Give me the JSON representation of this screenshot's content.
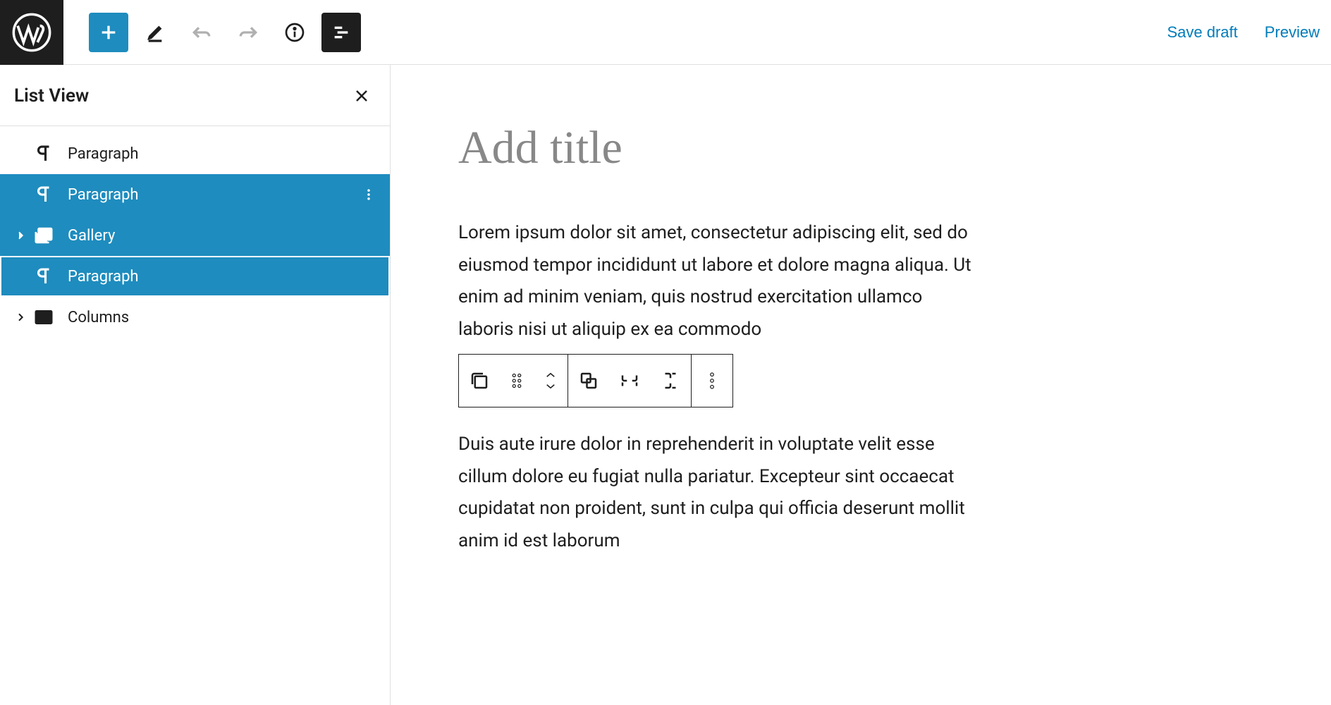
{
  "topbar": {
    "save_draft": "Save draft",
    "preview": "Preview"
  },
  "sidebar": {
    "title": "List View",
    "items": [
      {
        "type": "paragraph",
        "label": "Paragraph",
        "selected": false,
        "expandable": false
      },
      {
        "type": "paragraph",
        "label": "Paragraph",
        "selected": true,
        "expandable": false,
        "showOptions": true
      },
      {
        "type": "gallery",
        "label": "Gallery",
        "selected": true,
        "expandable": true
      },
      {
        "type": "paragraph",
        "label": "Paragraph",
        "selected": true,
        "expandable": false,
        "focused": true
      },
      {
        "type": "columns",
        "label": "Columns",
        "selected": false,
        "expandable": true
      }
    ]
  },
  "editor": {
    "title_placeholder": "Add title",
    "paragraph1": "Lorem ipsum dolor sit amet, consectetur adipiscing elit, sed do eiusmod tempor incididunt ut labore et dolore magna aliqua. Ut enim ad minim veniam, quis nostrud exercitation ullamco laboris nisi ut aliquip ex ea commodo",
    "paragraph2": "Duis aute irure dolor in reprehenderit in voluptate velit esse cillum dolore eu fugiat nulla pariatur. Excepteur sint occaecat cupidatat non proident, sunt in culpa qui officia deserunt mollit anim id est laborum"
  }
}
